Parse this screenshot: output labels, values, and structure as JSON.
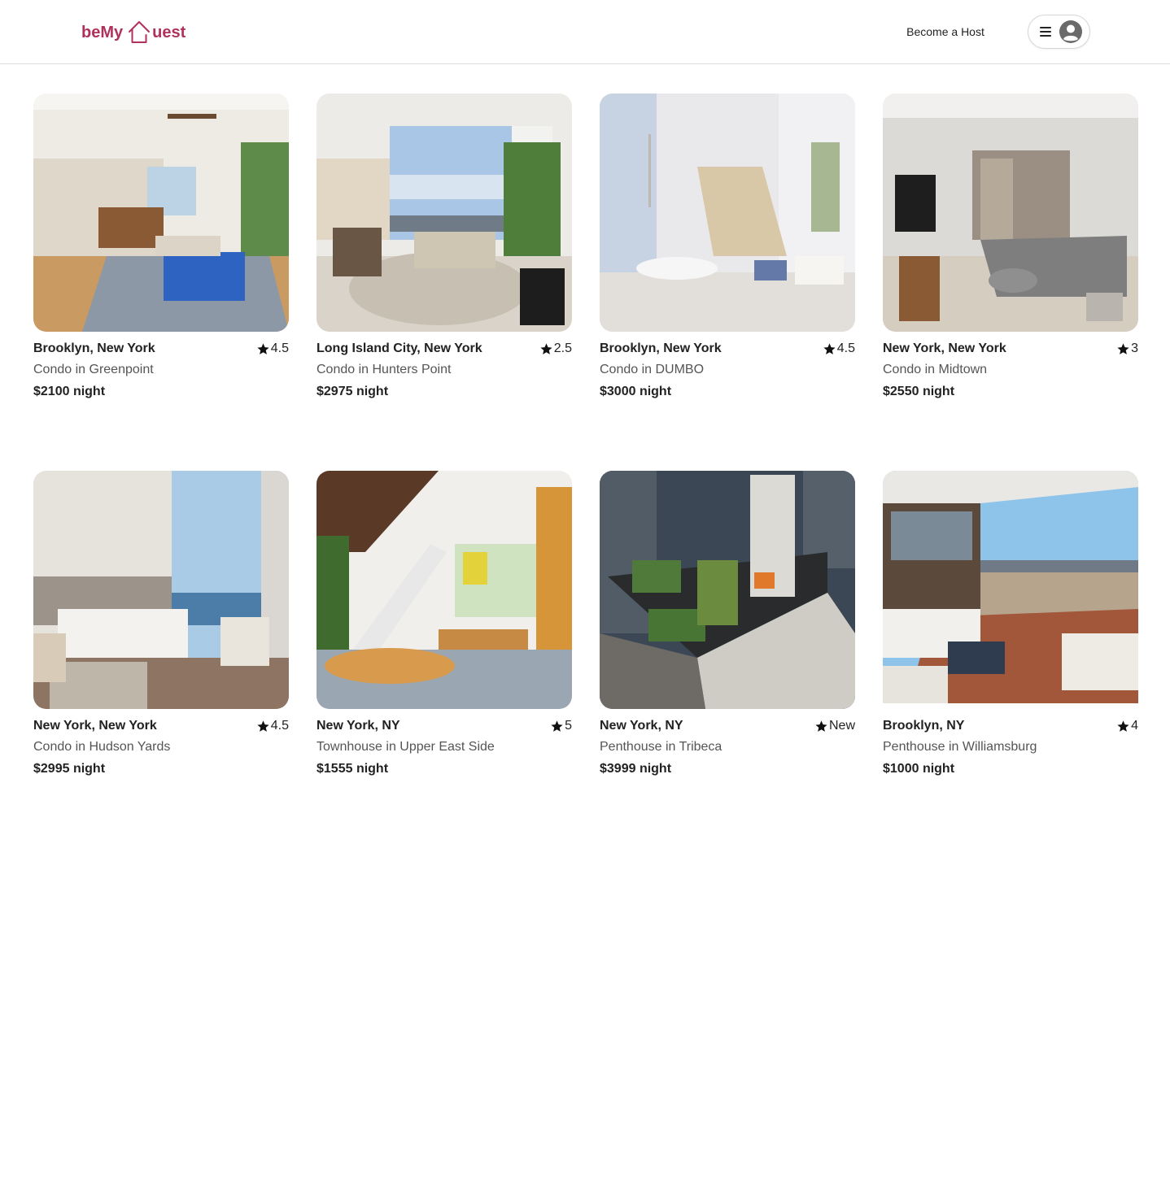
{
  "header": {
    "logo_left": "beMy",
    "logo_right": "uest",
    "become_host_label": "Become a Host"
  },
  "colors": {
    "brand": "#b0325b",
    "border": "#dcdcdc",
    "text": "#222222",
    "muted": "#555555"
  },
  "listings": [
    {
      "location": "Brooklyn, New York",
      "rating": "4.5",
      "type": "Condo in Greenpoint",
      "price": "$2100 night",
      "photo": "loft-living-room-blue-sofa"
    },
    {
      "location": "Long Island City, New York",
      "rating": "2.5",
      "type": "Condo in Hunters Point",
      "price": "$2975 night",
      "photo": "living-room-city-view"
    },
    {
      "location": "Brooklyn, New York",
      "rating": "4.5",
      "type": "Condo in DUMBO",
      "price": "$3000 night",
      "photo": "duplex-dining-room"
    },
    {
      "location": "New York, New York",
      "rating": "3",
      "type": "Condo in Midtown",
      "price": "$2550 night",
      "photo": "living-room-sectional"
    },
    {
      "location": "New York, New York",
      "rating": "4.5",
      "type": "Condo in Hudson Yards",
      "price": "$2995 night",
      "photo": "bedroom-river-view"
    },
    {
      "location": "New York, NY",
      "rating": "5",
      "type": "Townhouse in Upper East Side",
      "price": "$1555 night",
      "photo": "loft-staircase"
    },
    {
      "location": "New York, NY",
      "rating": "New",
      "type": "Penthouse in Tribeca",
      "price": "$3999 night",
      "photo": "rooftop-terrace"
    },
    {
      "location": "Brooklyn, NY",
      "rating": "4",
      "type": "Penthouse in Williamsburg",
      "price": "$1000 night",
      "photo": "terrace-skyline"
    }
  ]
}
